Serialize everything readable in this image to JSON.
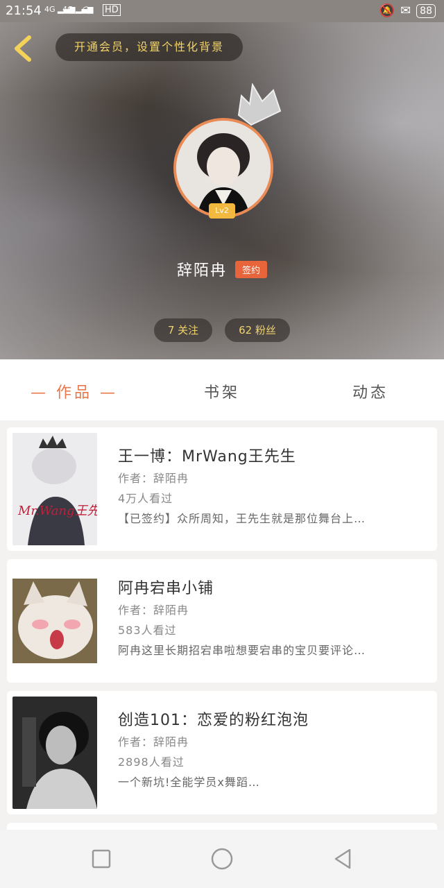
{
  "status": {
    "time": "21:54",
    "network1": "4G",
    "network2": "4G",
    "hd": "HD",
    "battery": "88"
  },
  "header": {
    "vip_banner": "开通会员，设置个性化背景"
  },
  "profile": {
    "level": "Lv2",
    "name": "辞陌冉",
    "sign_badge": "签约",
    "follow": "7 关注",
    "fans": "62 粉丝"
  },
  "tabs": [
    {
      "label": "— 作品 —"
    },
    {
      "label": "书架"
    },
    {
      "label": "动态"
    }
  ],
  "works": [
    {
      "title": "王一博：MrWang王先生",
      "author": "作者：辞陌冉",
      "views": "4万人看过",
      "desc": "【已签约】众所周知，王先生就是那位舞台上…",
      "cover_text": "Mr.Wang王先生"
    },
    {
      "title": "阿冉宕串小铺",
      "author": "作者：辞陌冉",
      "views": "583人看过",
      "desc": "阿冉这里长期招宕串啦想要宕串的宝贝要评论…"
    },
    {
      "title": "创造101：恋爱的粉红泡泡",
      "author": "作者：辞陌冉",
      "views": "2898人看过",
      "desc": "一个新坑!全能学员x舞蹈…"
    }
  ],
  "colors": {
    "accent": "#e8784a",
    "gold": "#f1d36b",
    "badge": "#e8643a"
  }
}
